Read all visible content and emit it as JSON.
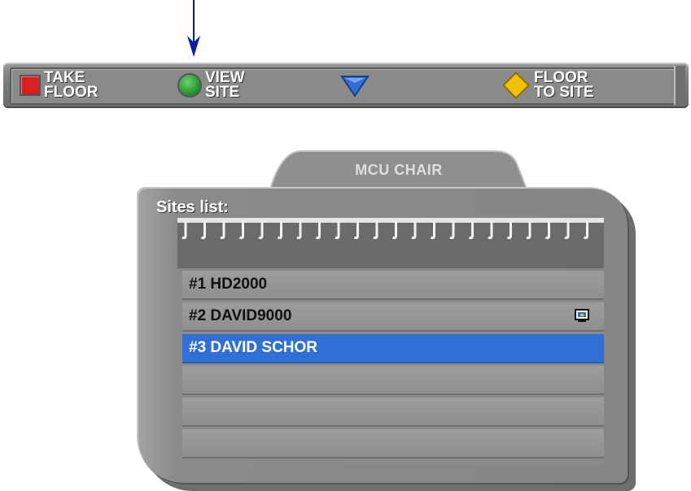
{
  "toolbar": {
    "buttons": [
      {
        "label": "TAKE\nFLOOR",
        "icon": "red-square-icon",
        "color": "#d82020"
      },
      {
        "label": "VIEW\nSITE",
        "icon": "green-circle-icon",
        "color": "#1d8f2a"
      },
      {
        "label": "",
        "icon": "blue-triangle-icon",
        "color": "#2f6fd6"
      },
      {
        "label": "FLOOR\nTO SITE",
        "icon": "yellow-diamond-icon",
        "color": "#f2c200"
      }
    ]
  },
  "panel": {
    "tab_title": "MCU CHAIR",
    "sites_title": "Sites list:",
    "sites": [
      {
        "label": "#1 HD2000",
        "selected": false,
        "icon": ""
      },
      {
        "label": "#2 DAVID9000",
        "selected": false,
        "icon": "monitor-icon"
      },
      {
        "label": "#3 DAVID SCHOR",
        "selected": true,
        "icon": ""
      },
      {
        "label": "",
        "selected": false,
        "icon": ""
      },
      {
        "label": "",
        "selected": false,
        "icon": ""
      },
      {
        "label": "",
        "selected": false,
        "icon": ""
      }
    ]
  },
  "colors": {
    "selection": "#2f6fd6",
    "panel": "#8a8a8a",
    "arrow": "#0b1ea8"
  }
}
